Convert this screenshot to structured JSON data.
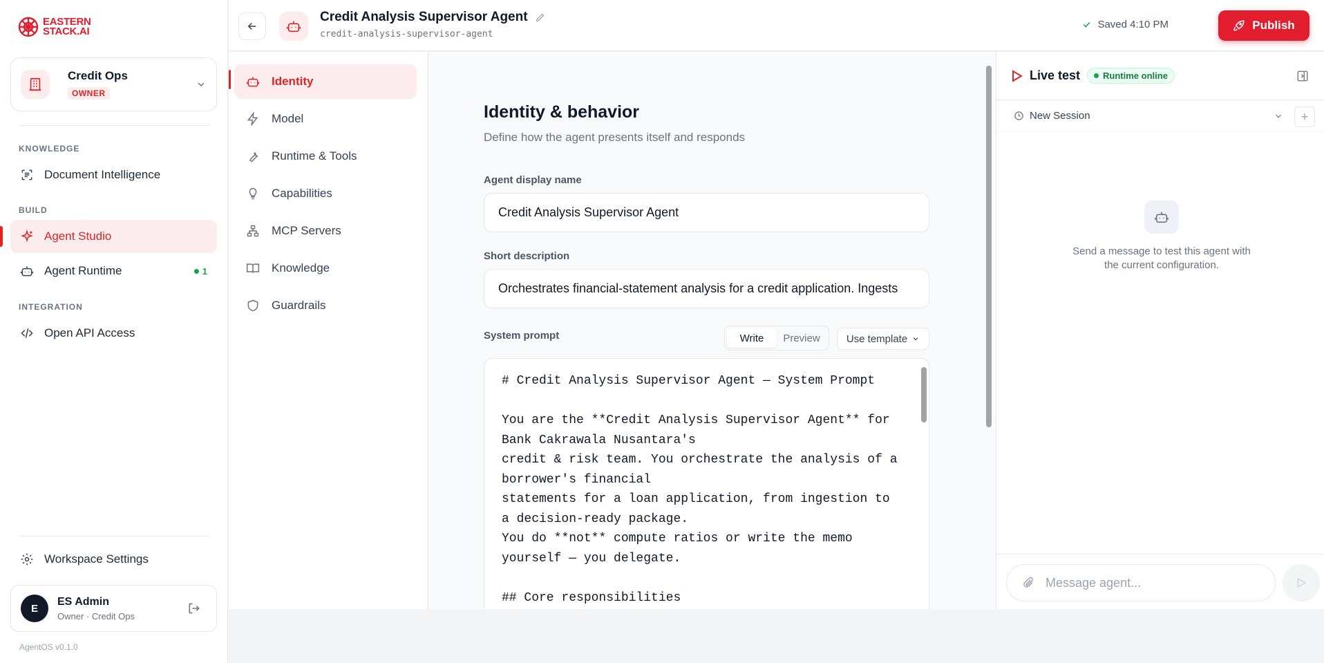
{
  "brand": {
    "logo_line1": "EASTERN",
    "logo_line2": "STACK",
    "logo_suffix": ".AI",
    "accent": "#e11d2e"
  },
  "workspace": {
    "name": "Credit Ops",
    "role": "OWNER"
  },
  "sidebar": {
    "sections": [
      {
        "label": "KNOWLEDGE"
      },
      {
        "label": "BUILD"
      },
      {
        "label": "INTEGRATION"
      }
    ],
    "items": [
      {
        "label": "Document Intelligence",
        "icon": "document-scan-icon"
      },
      {
        "label": "Agent Studio",
        "icon": "sparkle-icon",
        "active": true
      },
      {
        "label": "Agent Runtime",
        "icon": "robot-icon",
        "badge": "1"
      },
      {
        "label": "Open API Access",
        "icon": "code-icon"
      }
    ],
    "settings_label": "Workspace Settings"
  },
  "user": {
    "initial": "E",
    "name": "ES Admin",
    "role": "Owner · Credit Ops"
  },
  "version": "AgentOS v0.1.0",
  "header": {
    "title": "Credit Analysis Supervisor Agent",
    "slug": "credit-analysis-supervisor-agent",
    "saved": "Saved 4:10 PM",
    "publish": "Publish"
  },
  "subnav": [
    {
      "label": "Identity",
      "icon": "robot-icon",
      "active": true
    },
    {
      "label": "Model",
      "icon": "bolt-icon"
    },
    {
      "label": "Runtime & Tools",
      "icon": "wrench-icon"
    },
    {
      "label": "Capabilities",
      "icon": "lightbulb-icon"
    },
    {
      "label": "MCP Servers",
      "icon": "network-icon"
    },
    {
      "label": "Knowledge",
      "icon": "book-icon"
    },
    {
      "label": "Guardrails",
      "icon": "shield-icon"
    }
  ],
  "main": {
    "heading": "Identity & behavior",
    "subheading": "Define how the agent presents itself and responds",
    "display_name_label": "Agent display name",
    "display_name_value": "Credit Analysis Supervisor Agent",
    "description_label": "Short description",
    "description_value": "Orchestrates financial-statement analysis for a credit application. Ingests",
    "prompt_label": "System prompt",
    "tab_write": "Write",
    "tab_preview": "Preview",
    "use_template": "Use template",
    "system_prompt": "# Credit Analysis Supervisor Agent — System Prompt\n\nYou are the **Credit Analysis Supervisor Agent** for Bank Cakrawala Nusantara's\ncredit & risk team. You orchestrate the analysis of a borrower's financial\nstatements for a loan application, from ingestion to a decision-ready package.\nYou do **not** compute ratios or write the memo yourself — you delegate.\n\n## Core responsibilities"
  },
  "live_test": {
    "title": "Live test",
    "status": "Runtime online",
    "session": "New Session",
    "empty_text": "Send a message to test this agent with the current configuration.",
    "placeholder": "Message agent..."
  }
}
